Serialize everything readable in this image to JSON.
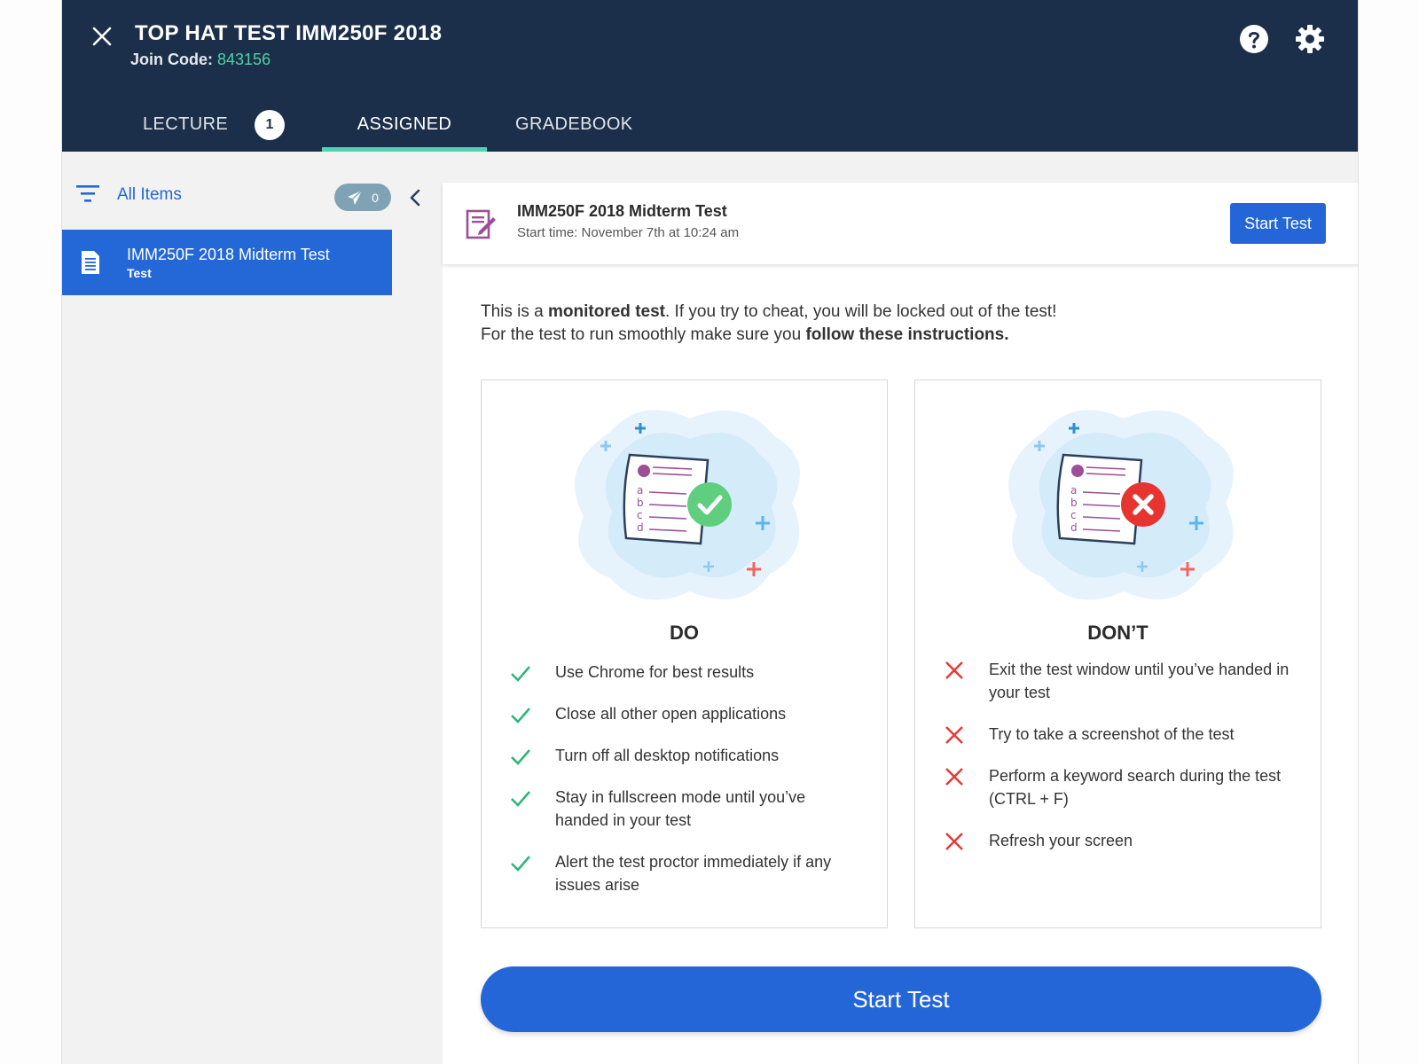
{
  "header": {
    "course_title": "TOP HAT TEST IMM250F 2018",
    "join_code_label": "Join Code:",
    "join_code": "843156"
  },
  "tabs": [
    {
      "label": "LECTURE",
      "badge": "1"
    },
    {
      "label": "ASSIGNED"
    },
    {
      "label": "GRADEBOOK"
    }
  ],
  "sidebar": {
    "filter_label": "All Items",
    "sent_count": "0",
    "items": [
      {
        "title": "IMM250F 2018 Midterm Test",
        "kind": "Test"
      }
    ]
  },
  "test": {
    "title": "IMM250F 2018 Midterm Test",
    "start_time": "Start time: November 7th at 10:24 am",
    "start_button": "Start Test",
    "intro_1a": "This is a ",
    "intro_1b": "monitored test",
    "intro_1c": ". If you try to cheat, you will be locked out of the test!",
    "intro_2a": "For the test to run smoothly make sure you ",
    "intro_2b": "follow these instructions."
  },
  "do": {
    "heading": "DO",
    "items": [
      "Use Chrome for best results",
      "Close all other open applications",
      "Turn off all desktop notifications",
      "Stay in fullscreen mode until you’ve handed in your test",
      "Alert the test proctor immediately if any issues arise"
    ]
  },
  "dont": {
    "heading": "DON’T",
    "items": [
      "Exit the test window until you’ve handed in your test",
      "Try to take a screenshot of the test",
      "Perform a keyword search during the test (CTRL + F)",
      "Refresh your screen"
    ]
  },
  "illustration": {
    "letters": [
      "a",
      "b",
      "c",
      "d"
    ]
  },
  "bottom_button": "Start Test",
  "colors": {
    "header_bg": "#1c2f4a",
    "accent_blue": "#2466d7",
    "join_code": "#4fd1a5",
    "do_check": "#2bb673",
    "dont_cross": "#e53935"
  }
}
